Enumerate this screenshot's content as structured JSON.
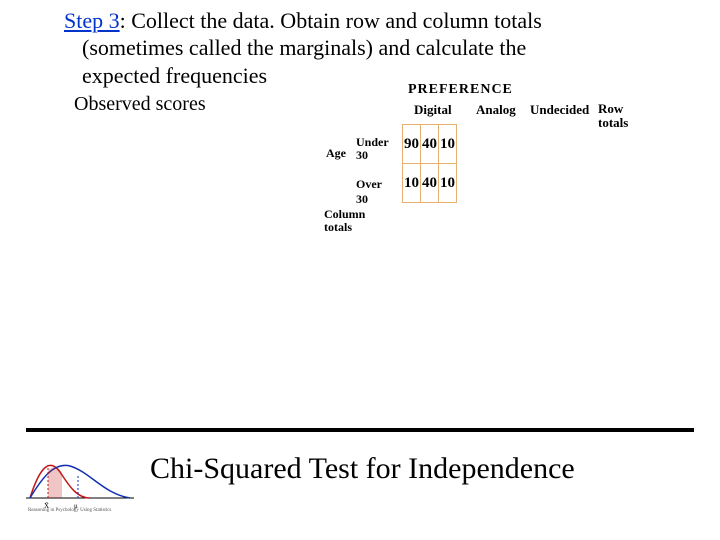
{
  "step": {
    "label": "Step 3",
    "sep": ": ",
    "line1_rest": "Collect the data.  Obtain row and column totals",
    "line2": "(sometimes called the marginals) and calculate the",
    "line3": "expected frequencies"
  },
  "observed_label": "Observed scores",
  "preference_title": "PREFERENCE",
  "headers": {
    "digital": "Digital",
    "analog": "Analog",
    "undecided": "Undecided",
    "row_totals": "Row\ntotals"
  },
  "age_label": "Age",
  "row_labels": {
    "under30": "Under\n30",
    "over30": "Over 30"
  },
  "col_totals_label": "Column\ntotals",
  "footer_title": "Chi-Squared Test for Independence",
  "chart_data": {
    "type": "table",
    "title": "Observed scores — PREFERENCE by Age",
    "row_categories": [
      "Under 30",
      "Over 30"
    ],
    "col_categories": [
      "Digital",
      "Analog",
      "Undecided"
    ],
    "values": [
      [
        90,
        40,
        10
      ],
      [
        10,
        40,
        10
      ]
    ],
    "row_totals": [
      null,
      null
    ],
    "col_totals": [
      null,
      null,
      null
    ]
  }
}
